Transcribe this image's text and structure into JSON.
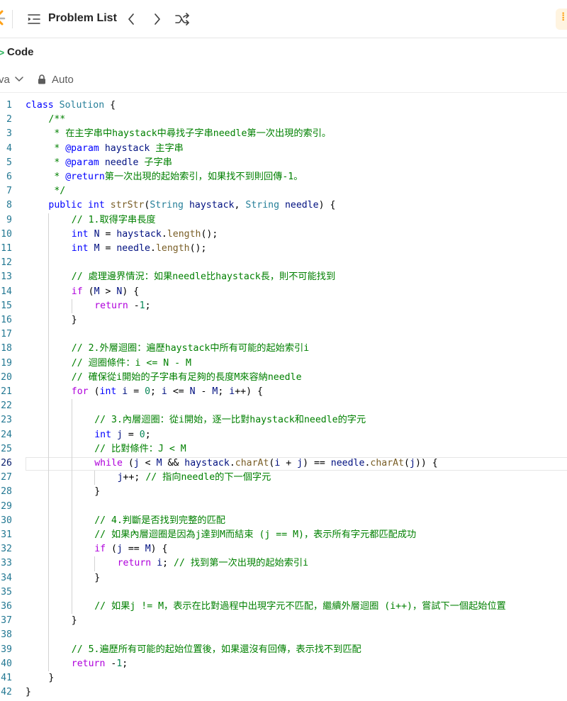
{
  "nav": {
    "problem_list_label": "Problem List"
  },
  "panel": {
    "code_title": "Code",
    "language": "va",
    "mode": "Auto"
  },
  "colors": {
    "brand_orange": "#ffa116",
    "accent_green": "#2db55d",
    "keyword": "#0000ff",
    "comment": "#008000",
    "type": "#267f99",
    "function": "#795e26",
    "variable": "#001080",
    "number": "#098658",
    "control": "#af00db",
    "line_number": "#237893"
  },
  "icons": [
    "leetcode-logo-icon",
    "problem-list-icon",
    "chevron-left-icon",
    "chevron-right-icon",
    "shuffle-icon",
    "chevron-down-icon",
    "lock-icon"
  ],
  "editor": {
    "current_line": 26,
    "lines": [
      {
        "n": "1",
        "indent": 0,
        "tokens": [
          [
            "kw",
            "class"
          ],
          [
            "op",
            " "
          ],
          [
            "ty",
            "Solution"
          ],
          [
            "op",
            " {"
          ]
        ]
      },
      {
        "n": "2",
        "indent": 1,
        "tokens": [
          [
            "cm",
            "/**"
          ]
        ]
      },
      {
        "n": "3",
        "indent": 1,
        "tokens": [
          [
            "cm",
            " * 在主字串中haystack中尋找子字串needle第一次出現的索引。"
          ]
        ]
      },
      {
        "n": "4",
        "indent": 1,
        "tokens": [
          [
            "cm",
            " * "
          ],
          [
            "kw",
            "@param"
          ],
          [
            "cm",
            " "
          ],
          [
            "va",
            "haystack"
          ],
          [
            "cm",
            " 主字串"
          ]
        ]
      },
      {
        "n": "5",
        "indent": 1,
        "tokens": [
          [
            "cm",
            " * "
          ],
          [
            "kw",
            "@param"
          ],
          [
            "cm",
            " "
          ],
          [
            "va",
            "needle"
          ],
          [
            "cm",
            " 子字串"
          ]
        ]
      },
      {
        "n": "6",
        "indent": 1,
        "tokens": [
          [
            "cm",
            " * "
          ],
          [
            "kw",
            "@return"
          ],
          [
            "cm",
            "第一次出現的起始索引，如果找不到則回傳-1。"
          ]
        ]
      },
      {
        "n": "7",
        "indent": 1,
        "tokens": [
          [
            "cm",
            " */"
          ]
        ]
      },
      {
        "n": "8",
        "indent": 1,
        "tokens": [
          [
            "kw",
            "public"
          ],
          [
            "op",
            " "
          ],
          [
            "kw",
            "int"
          ],
          [
            "op",
            " "
          ],
          [
            "fn",
            "strStr"
          ],
          [
            "op",
            "("
          ],
          [
            "ty",
            "String"
          ],
          [
            "op",
            " "
          ],
          [
            "va",
            "haystack"
          ],
          [
            "op",
            ", "
          ],
          [
            "ty",
            "String"
          ],
          [
            "op",
            " "
          ],
          [
            "va",
            "needle"
          ],
          [
            "op",
            ") {"
          ]
        ]
      },
      {
        "n": "9",
        "indent": 2,
        "tokens": [
          [
            "cm",
            "// 1.取得字串長度"
          ]
        ]
      },
      {
        "n": "10",
        "indent": 2,
        "tokens": [
          [
            "kw",
            "int"
          ],
          [
            "op",
            " "
          ],
          [
            "va",
            "N"
          ],
          [
            "op",
            " = "
          ],
          [
            "va",
            "haystack"
          ],
          [
            "op",
            "."
          ],
          [
            "fn",
            "length"
          ],
          [
            "op",
            "();"
          ]
        ]
      },
      {
        "n": "11",
        "indent": 2,
        "tokens": [
          [
            "kw",
            "int"
          ],
          [
            "op",
            " "
          ],
          [
            "va",
            "M"
          ],
          [
            "op",
            " = "
          ],
          [
            "va",
            "needle"
          ],
          [
            "op",
            "."
          ],
          [
            "fn",
            "length"
          ],
          [
            "op",
            "();"
          ]
        ]
      },
      {
        "n": "12",
        "indent": 0,
        "tokens": []
      },
      {
        "n": "13",
        "indent": 2,
        "tokens": [
          [
            "cm",
            "// 處理邊界情況：如果needle比haystack長，則不可能找到"
          ]
        ]
      },
      {
        "n": "14",
        "indent": 2,
        "tokens": [
          [
            "ck",
            "if"
          ],
          [
            "op",
            " ("
          ],
          [
            "va",
            "M"
          ],
          [
            "op",
            " > "
          ],
          [
            "va",
            "N"
          ],
          [
            "op",
            ") {"
          ]
        ]
      },
      {
        "n": "15",
        "indent": 3,
        "tokens": [
          [
            "ck",
            "return"
          ],
          [
            "op",
            " -"
          ],
          [
            "nu",
            "1"
          ],
          [
            "op",
            ";"
          ]
        ]
      },
      {
        "n": "16",
        "indent": 2,
        "tokens": [
          [
            "op",
            "}"
          ]
        ]
      },
      {
        "n": "17",
        "indent": 0,
        "tokens": []
      },
      {
        "n": "18",
        "indent": 2,
        "tokens": [
          [
            "cm",
            "// 2.外層迴圈：遍歷haystack中所有可能的起始索引i"
          ]
        ]
      },
      {
        "n": "19",
        "indent": 2,
        "tokens": [
          [
            "cm",
            "// 迴圈條件：i <= N - M"
          ]
        ]
      },
      {
        "n": "20",
        "indent": 2,
        "tokens": [
          [
            "cm",
            "// 確保從i開始的子字串有足夠的長度M來容納needle"
          ]
        ]
      },
      {
        "n": "21",
        "indent": 2,
        "tokens": [
          [
            "ck",
            "for"
          ],
          [
            "op",
            " ("
          ],
          [
            "kw",
            "int"
          ],
          [
            "op",
            " "
          ],
          [
            "va",
            "i"
          ],
          [
            "op",
            " = "
          ],
          [
            "nu",
            "0"
          ],
          [
            "op",
            "; "
          ],
          [
            "va",
            "i"
          ],
          [
            "op",
            " <= "
          ],
          [
            "va",
            "N"
          ],
          [
            "op",
            " - "
          ],
          [
            "va",
            "M"
          ],
          [
            "op",
            "; "
          ],
          [
            "va",
            "i"
          ],
          [
            "op",
            "++) {"
          ]
        ]
      },
      {
        "n": "22",
        "indent": 0,
        "tokens": []
      },
      {
        "n": "23",
        "indent": 3,
        "tokens": [
          [
            "cm",
            "// 3.內層迴圈：從i開始，逐一比對haystack和needle的字元"
          ]
        ]
      },
      {
        "n": "24",
        "indent": 3,
        "tokens": [
          [
            "kw",
            "int"
          ],
          [
            "op",
            " "
          ],
          [
            "va",
            "j"
          ],
          [
            "op",
            " = "
          ],
          [
            "nu",
            "0"
          ],
          [
            "op",
            ";"
          ]
        ]
      },
      {
        "n": "25",
        "indent": 3,
        "tokens": [
          [
            "cm",
            "// 比對條件：J < M"
          ]
        ]
      },
      {
        "n": "26",
        "indent": 3,
        "tokens": [
          [
            "ck",
            "while"
          ],
          [
            "op",
            " ("
          ],
          [
            "va",
            "j"
          ],
          [
            "op",
            " < "
          ],
          [
            "va",
            "M"
          ],
          [
            "op",
            " && "
          ],
          [
            "va",
            "haystack"
          ],
          [
            "op",
            "."
          ],
          [
            "fn",
            "charAt"
          ],
          [
            "op",
            "("
          ],
          [
            "va",
            "i"
          ],
          [
            "op",
            " + "
          ],
          [
            "va",
            "j"
          ],
          [
            "op",
            ") == "
          ],
          [
            "va",
            "needle"
          ],
          [
            "op",
            "."
          ],
          [
            "fn",
            "charAt"
          ],
          [
            "op",
            "("
          ],
          [
            "va",
            "j"
          ],
          [
            "op",
            ")) {"
          ]
        ]
      },
      {
        "n": "27",
        "indent": 4,
        "tokens": [
          [
            "va",
            "j"
          ],
          [
            "op",
            "++; "
          ],
          [
            "cm",
            "// 指向needle的下一個字元"
          ]
        ]
      },
      {
        "n": "28",
        "indent": 3,
        "tokens": [
          [
            "op",
            "}"
          ]
        ]
      },
      {
        "n": "29",
        "indent": 0,
        "tokens": []
      },
      {
        "n": "30",
        "indent": 3,
        "tokens": [
          [
            "cm",
            "// 4.判斷是否找到完整的匹配"
          ]
        ]
      },
      {
        "n": "31",
        "indent": 3,
        "tokens": [
          [
            "cm",
            "// 如果內層迴圈是因為j達到M而結束 (j == M)，表示所有字元都匹配成功"
          ]
        ]
      },
      {
        "n": "32",
        "indent": 3,
        "tokens": [
          [
            "ck",
            "if"
          ],
          [
            "op",
            " ("
          ],
          [
            "va",
            "j"
          ],
          [
            "op",
            " == "
          ],
          [
            "va",
            "M"
          ],
          [
            "op",
            ") {"
          ]
        ]
      },
      {
        "n": "33",
        "indent": 4,
        "tokens": [
          [
            "ck",
            "return"
          ],
          [
            "op",
            " "
          ],
          [
            "va",
            "i"
          ],
          [
            "op",
            "; "
          ],
          [
            "cm",
            "// 找到第一次出現的起始索引i"
          ]
        ]
      },
      {
        "n": "34",
        "indent": 3,
        "tokens": [
          [
            "op",
            "}"
          ]
        ]
      },
      {
        "n": "35",
        "indent": 0,
        "tokens": []
      },
      {
        "n": "36",
        "indent": 3,
        "tokens": [
          [
            "cm",
            "// 如果j != M，表示在比對過程中出現字元不匹配，繼續外層迴圈 (i++)，嘗試下一個起始位置"
          ]
        ]
      },
      {
        "n": "37",
        "indent": 2,
        "tokens": [
          [
            "op",
            "}"
          ]
        ]
      },
      {
        "n": "38",
        "indent": 0,
        "tokens": []
      },
      {
        "n": "39",
        "indent": 2,
        "tokens": [
          [
            "cm",
            "// 5.遍歷所有可能的起始位置後，如果還沒有回傳，表示找不到匹配"
          ]
        ]
      },
      {
        "n": "40",
        "indent": 2,
        "tokens": [
          [
            "ck",
            "return"
          ],
          [
            "op",
            " -"
          ],
          [
            "nu",
            "1"
          ],
          [
            "op",
            ";"
          ]
        ]
      },
      {
        "n": "41",
        "indent": 1,
        "tokens": [
          [
            "op",
            "}"
          ]
        ]
      },
      {
        "n": "42",
        "indent": 0,
        "tokens": [
          [
            "op",
            "}"
          ]
        ]
      }
    ]
  }
}
